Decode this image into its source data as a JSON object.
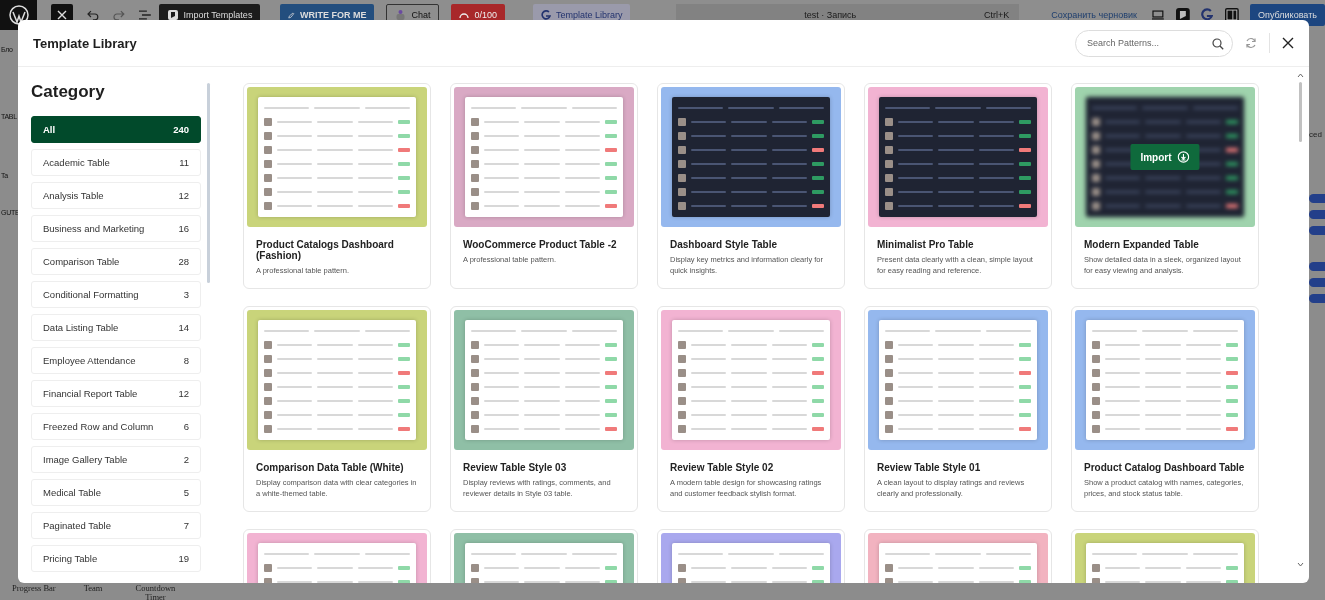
{
  "topbar": {
    "import_templates": "Import Templates",
    "write_for_me": "WRITE FOR ME",
    "chat": "Chat",
    "credits": "0/100",
    "template_library": "Template Library",
    "document_title": "test · Запись",
    "shortcut": "Ctrl+K",
    "save_draft": "Сохранить черновик",
    "publish": "Опубликовать"
  },
  "background": {
    "left_texts": [
      "Бло",
      "TABL",
      "Ta",
      "GUTE"
    ],
    "bottom_labels": [
      "Progress Bar",
      "Team",
      "Countdown Timer"
    ],
    "right_text": "ced",
    "toggles": [
      {
        "on": true
      },
      {
        "on": true
      },
      {
        "on": true
      },
      {
        "on": true
      },
      {
        "on": true
      },
      {
        "on": true
      }
    ]
  },
  "modal": {
    "title": "Template Library",
    "search": {
      "placeholder": "Search Patterns..."
    },
    "sidebar_heading": "Category",
    "import_label": "Import",
    "categories": [
      {
        "label": "All",
        "count": "240",
        "selected": true
      },
      {
        "label": "Academic Table",
        "count": "11",
        "selected": false
      },
      {
        "label": "Analysis Table",
        "count": "12",
        "selected": false
      },
      {
        "label": "Business and Marketing",
        "count": "16",
        "selected": false
      },
      {
        "label": "Comparison Table",
        "count": "28",
        "selected": false
      },
      {
        "label": "Conditional Formatting",
        "count": "3",
        "selected": false
      },
      {
        "label": "Data Listing Table",
        "count": "14",
        "selected": false
      },
      {
        "label": "Employee Attendance",
        "count": "8",
        "selected": false
      },
      {
        "label": "Financial Report Table",
        "count": "12",
        "selected": false
      },
      {
        "label": "Freezed Row and Column",
        "count": "6",
        "selected": false
      },
      {
        "label": "Image Gallery Table",
        "count": "2",
        "selected": false
      },
      {
        "label": "Medical Table",
        "count": "5",
        "selected": false
      },
      {
        "label": "Paginated Table",
        "count": "7",
        "selected": false
      },
      {
        "label": "Pricing Table",
        "count": "19",
        "selected": false
      }
    ],
    "cards": [
      {
        "title": "Product Catalogs Dashboard (Fashion)",
        "description": "A professional table pattern.",
        "color": "#c9d47a",
        "kind": "light",
        "hovered": false
      },
      {
        "title": "WooCommerce Product Table -2",
        "description": "A professional table pattern.",
        "color": "#d9a9c4",
        "kind": "light",
        "hovered": false
      },
      {
        "title": "Dashboard Style Table",
        "description": "Display key metrics and information clearly for quick insights.",
        "color": "#95b8ee",
        "kind": "dark",
        "hovered": false
      },
      {
        "title": "Minimalist Pro Table",
        "description": "Present data clearly with a clean, simple layout for easy reading and reference.",
        "color": "#f2b3d2",
        "kind": "dark",
        "hovered": false
      },
      {
        "title": "Modern Expanded Table",
        "description": "Show detailed data in a sleek, organized layout for easy viewing and analysis.",
        "color": "#9fd3ad",
        "kind": "dark",
        "hovered": true
      },
      {
        "title": "Comparison Data Table (White)",
        "description": "Display comparison data with clear categories in a white-themed table.",
        "color": "#c9d47a",
        "kind": "light",
        "hovered": false
      },
      {
        "title": "Review Table Style 03",
        "description": "Display reviews with ratings, comments, and reviewer details in Style 03 table.",
        "color": "#8fbfa6",
        "kind": "light",
        "hovered": false
      },
      {
        "title": "Review Table Style 02",
        "description": "A modern table design for showcasing ratings and customer feedback stylish format.",
        "color": "#f2b3d2",
        "kind": "light",
        "hovered": false
      },
      {
        "title": "Review Table Style 01",
        "description": "A clean layout to display ratings and reviews clearly and professionally.",
        "color": "#95b8ee",
        "kind": "light",
        "hovered": false
      },
      {
        "title": "Product Catalog Dashboard Table",
        "description": "Show a product catalog with names, categories, prices, and stock status table.",
        "color": "#95b8ee",
        "kind": "light",
        "hovered": false
      },
      {
        "color": "#f2b3d2",
        "kind": "light",
        "hovered": false
      },
      {
        "color": "#8fbfa6",
        "kind": "light",
        "hovered": false
      },
      {
        "color": "#a9a8ee",
        "kind": "light",
        "hovered": false
      },
      {
        "color": "#f2b3c0",
        "kind": "light",
        "hovered": false
      },
      {
        "color": "#c9d47a",
        "kind": "light",
        "hovered": false
      }
    ]
  }
}
